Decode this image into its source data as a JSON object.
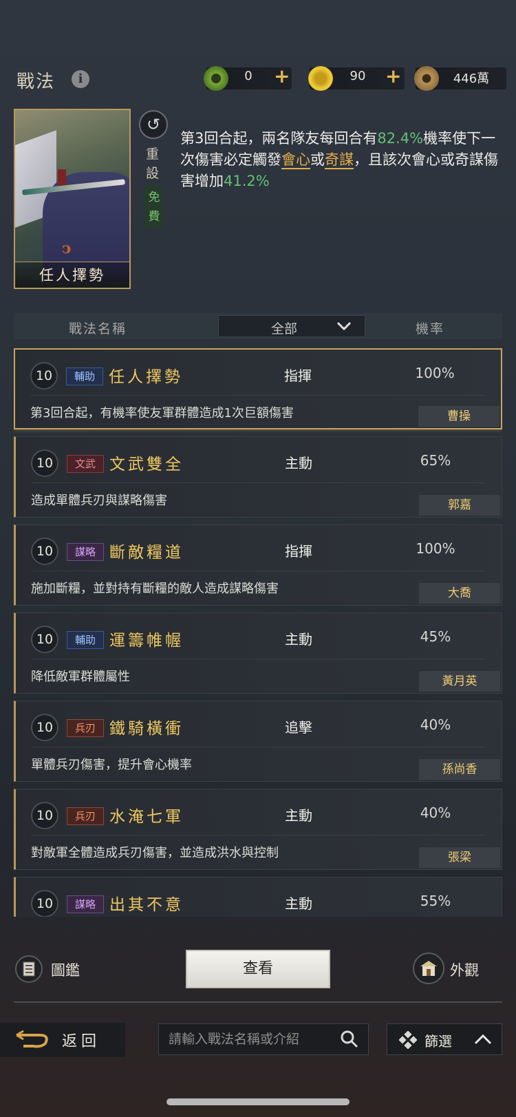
{
  "header": {
    "title": "戰法",
    "info_icon": "i",
    "currencies": [
      {
        "icon": "jade-coin-icon",
        "value": "0"
      },
      {
        "icon": "gold-coin-icon",
        "value": "90"
      },
      {
        "icon": "copper-coin-icon",
        "value": "446萬"
      }
    ],
    "plus": "+"
  },
  "hero": {
    "name": "任人擇勢",
    "reset_label": "重設",
    "free_label": "免費",
    "desc_parts": [
      "第3回合起，兩名隊友每回合有",
      "82.4%",
      "機率使下一次傷害必定觸發",
      "會心",
      "或",
      "奇謀",
      "，且該次會心或奇謀傷害增加",
      "41.2%"
    ]
  },
  "table": {
    "col_name": "戰法名稱",
    "filter": "全部",
    "col_rate": "機率"
  },
  "skills": [
    {
      "level": "10",
      "tag": "輔助",
      "tag_color": "blue",
      "name": "任人擇勢",
      "type": "指揮",
      "rate": "100%",
      "desc": "第3回合起，有機率使友軍群體造成1次巨額傷害",
      "hero": "曹操",
      "selected": true
    },
    {
      "level": "10",
      "tag": "文武",
      "tag_color": "red",
      "name": "文武雙全",
      "type": "主動",
      "rate": "65%",
      "desc": "造成單體兵刃與謀略傷害",
      "hero": "郭嘉"
    },
    {
      "level": "10",
      "tag": "謀略",
      "tag_color": "purple",
      "name": "斷敵糧道",
      "type": "指揮",
      "rate": "100%",
      "desc": "施加斷糧，並對持有斷糧的敵人造成謀略傷害",
      "hero": "大喬"
    },
    {
      "level": "10",
      "tag": "輔助",
      "tag_color": "blue",
      "name": "運籌帷幄",
      "type": "主動",
      "rate": "45%",
      "desc": "降低敵軍群體屬性",
      "hero": "黃月英"
    },
    {
      "level": "10",
      "tag": "兵刃",
      "tag_color": "orange",
      "name": "鐵騎橫衝",
      "type": "追擊",
      "rate": "40%",
      "desc": "單體兵刃傷害，提升會心機率",
      "hero": "孫尚香"
    },
    {
      "level": "10",
      "tag": "兵刃",
      "tag_color": "orange",
      "name": "水淹七軍",
      "type": "主動",
      "rate": "40%",
      "desc": "對敵軍全體造成兵刃傷害，並造成洪水與控制",
      "hero": "張梁"
    },
    {
      "level": "10",
      "tag": "謀略",
      "tag_color": "purple",
      "name": "出其不意",
      "type": "主動",
      "rate": "55%",
      "desc": "",
      "hero": ""
    }
  ],
  "actions": {
    "catalog": "圖鑑",
    "view": "查看",
    "appearance": "外觀"
  },
  "footer": {
    "back": "返回",
    "search_placeholder": "請輸入戰法名稱或介紹",
    "filter": "篩選"
  },
  "colors": {
    "accent_gold": "#eec860",
    "highlight_green": "#63c074",
    "keyword_gold": "#e3ad4a"
  }
}
